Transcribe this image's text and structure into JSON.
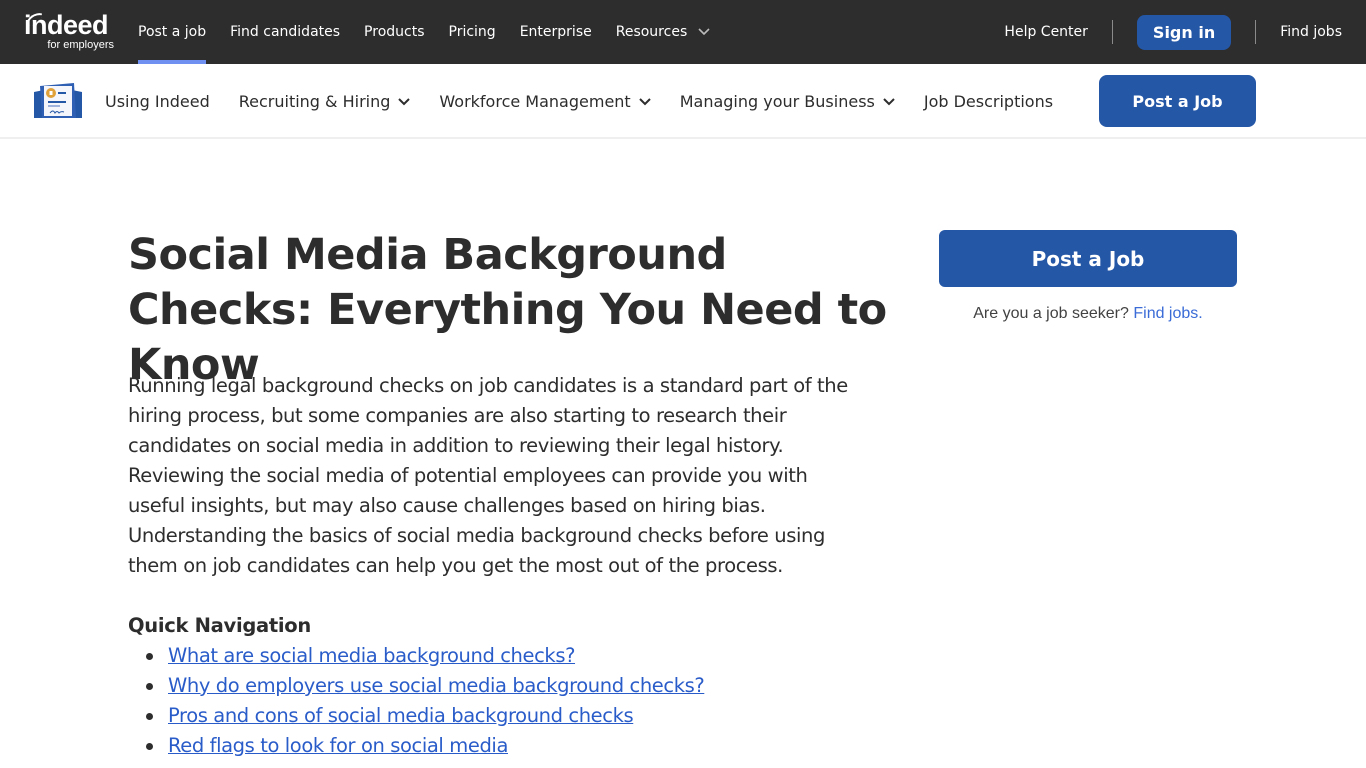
{
  "topbar": {
    "logo": {
      "word": "indeed",
      "sub": "for employers"
    },
    "nav": [
      {
        "label": "Post a job",
        "active": true
      },
      {
        "label": "Find candidates",
        "active": false
      },
      {
        "label": "Products",
        "active": false
      },
      {
        "label": "Pricing",
        "active": false
      },
      {
        "label": "Enterprise",
        "active": false
      },
      {
        "label": "Resources",
        "active": false,
        "dropdown": true
      }
    ],
    "help_center": "Help Center",
    "sign_in": "Sign in",
    "find_jobs": "Find jobs"
  },
  "subnav": {
    "items": [
      {
        "label": "Using Indeed",
        "dropdown": false
      },
      {
        "label": "Recruiting & Hiring",
        "dropdown": true
      },
      {
        "label": "Workforce Management",
        "dropdown": true
      },
      {
        "label": "Managing your Business",
        "dropdown": true
      },
      {
        "label": "Job Descriptions",
        "dropdown": false
      }
    ],
    "post_job": "Post a Job"
  },
  "article": {
    "title": "Social Media Background Checks: Everything You Need to Know",
    "intro": "Running legal background checks on job candidates is a standard part of the hiring process, but some companies are also starting to research their candidates on social media in addition to reviewing their legal history. Reviewing the social media of potential employees can provide you with useful insights, but may also cause challenges based on hiring bias. Understanding the basics of social media background checks before using them on job candidates can help you get the most out of the process.",
    "quick_nav_heading": "Quick Navigation",
    "quick_nav": [
      "What are social media background checks?",
      "Why do employers use social media background checks?",
      "Pros and cons of social media background checks",
      "Red flags to look for on social media"
    ]
  },
  "sidebar": {
    "post_job": "Post a Job",
    "seeker_text": "Are you a job seeker?",
    "seeker_link": "Find jobs."
  },
  "colors": {
    "topbar_bg": "#2d2d2d",
    "brand_blue": "#2557a7",
    "active_underline": "#6f8ff1",
    "link_blue": "#2a5cc9"
  }
}
